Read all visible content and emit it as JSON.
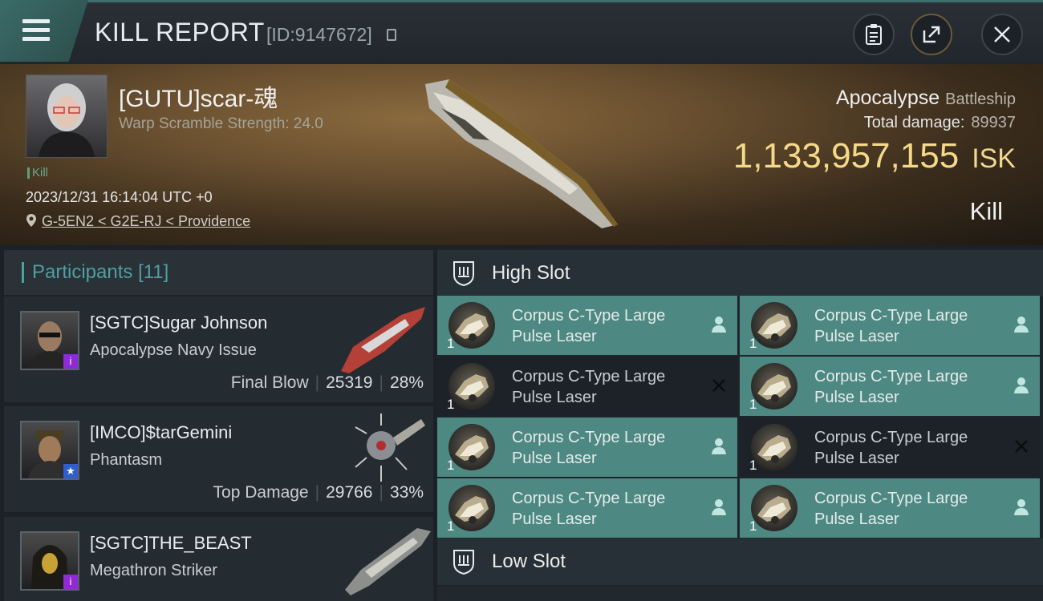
{
  "header": {
    "title": "KILL REPORT",
    "report_id": "[ID:9147672]",
    "icons": [
      "menu-icon",
      "copy-icon",
      "clipboard-icon",
      "share-icon",
      "close-icon"
    ]
  },
  "victim": {
    "name": "[GUTU]scar-魂",
    "warp_scramble": "Warp Scramble Strength: 24.0",
    "tag": "Kill",
    "datetime": "2023/12/31 16:14:04 UTC +0",
    "location": "G-5EN2 < G2E-RJ < Providence",
    "ship": "Apocalypse",
    "ship_class": "Battleship",
    "total_damage_label": "Total damage:",
    "total_damage": "89937",
    "isk_value": "1,133,957,155",
    "isk_unit": "ISK",
    "result": "Kill"
  },
  "participants": {
    "title": "Participants",
    "count": "[11]",
    "items": [
      {
        "name": "[SGTC]Sugar Johnson",
        "ship": "Apocalypse Navy Issue",
        "role": "Final Blow",
        "damage": "25319",
        "percent": "28%",
        "badge": "i",
        "badge_color": "#8e2bd6"
      },
      {
        "name": "[IMCO]$tarGemini",
        "ship": "Phantasm",
        "role": "Top Damage",
        "damage": "29766",
        "percent": "33%",
        "badge": "★",
        "badge_color": "#2f5ed0"
      },
      {
        "name": "[SGTC]THE_BEAST",
        "ship": "Megathron Striker",
        "role": "",
        "damage": "",
        "percent": "",
        "badge": "i",
        "badge_color": "#8e2bd6"
      }
    ]
  },
  "slots": {
    "high": {
      "title": "High Slot",
      "modules": [
        {
          "line1": "Corpus C-Type Large",
          "line2": "Pulse Laser",
          "qty": "1",
          "state": "dropped"
        },
        {
          "line1": "Corpus C-Type Large",
          "line2": "Pulse Laser",
          "qty": "1",
          "state": "dropped"
        },
        {
          "line1": "Corpus C-Type Large",
          "line2": "Pulse Laser",
          "qty": "1",
          "state": "destroyed"
        },
        {
          "line1": "Corpus C-Type Large",
          "line2": "Pulse Laser",
          "qty": "1",
          "state": "dropped"
        },
        {
          "line1": "Corpus C-Type Large",
          "line2": "Pulse Laser",
          "qty": "1",
          "state": "dropped"
        },
        {
          "line1": "Corpus C-Type Large",
          "line2": "Pulse Laser",
          "qty": "1",
          "state": "destroyed"
        },
        {
          "line1": "Corpus C-Type Large",
          "line2": "Pulse Laser",
          "qty": "1",
          "state": "dropped"
        },
        {
          "line1": "Corpus C-Type Large",
          "line2": "Pulse Laser",
          "qty": "1",
          "state": "dropped"
        }
      ]
    },
    "low": {
      "title": "Low Slot"
    }
  },
  "colors": {
    "accent": "#4f9fa3",
    "active_module": "#4d8883",
    "isk": "#f5d98a"
  }
}
